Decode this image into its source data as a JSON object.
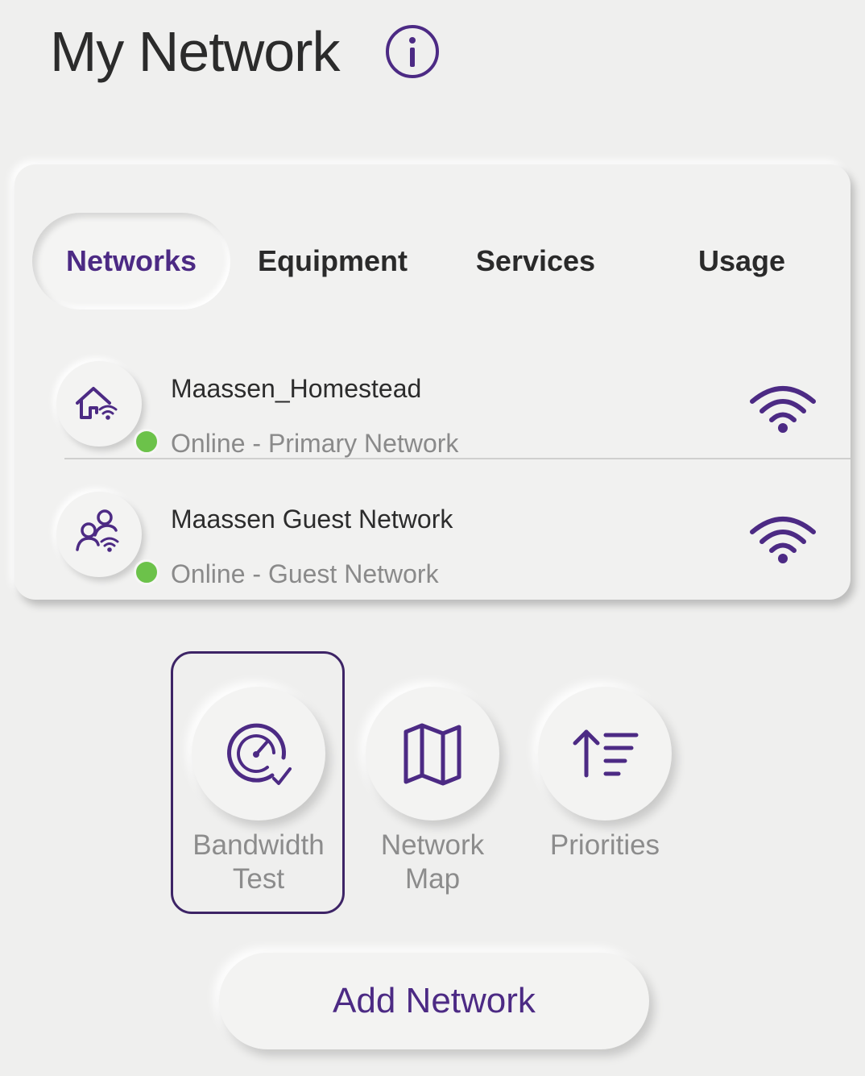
{
  "header": {
    "title": "My Network",
    "info_icon": "info-icon"
  },
  "tabs": [
    {
      "label": "Networks",
      "active": true
    },
    {
      "label": "Equipment",
      "active": false
    },
    {
      "label": "Services",
      "active": false
    },
    {
      "label": "Usage",
      "active": false
    }
  ],
  "networks": [
    {
      "name": "Maassen_Homestead",
      "status": "Online - Primary Network",
      "icon": "home-wifi-icon",
      "signal_icon": "wifi-icon"
    },
    {
      "name": "Maassen Guest Network",
      "status": "Online - Guest Network",
      "icon": "guest-users-wifi-icon",
      "signal_icon": "wifi-icon"
    }
  ],
  "actions": [
    {
      "label": "Bandwidth\nTest",
      "icon": "speedometer-icon"
    },
    {
      "label": "Network\nMap",
      "icon": "map-icon"
    },
    {
      "label": "Priorities",
      "icon": "priority-sort-icon"
    }
  ],
  "add_button": {
    "label": "Add Network"
  },
  "colors": {
    "accent": "#4c2a84",
    "online": "#6cc24a",
    "background": "#efefee"
  }
}
